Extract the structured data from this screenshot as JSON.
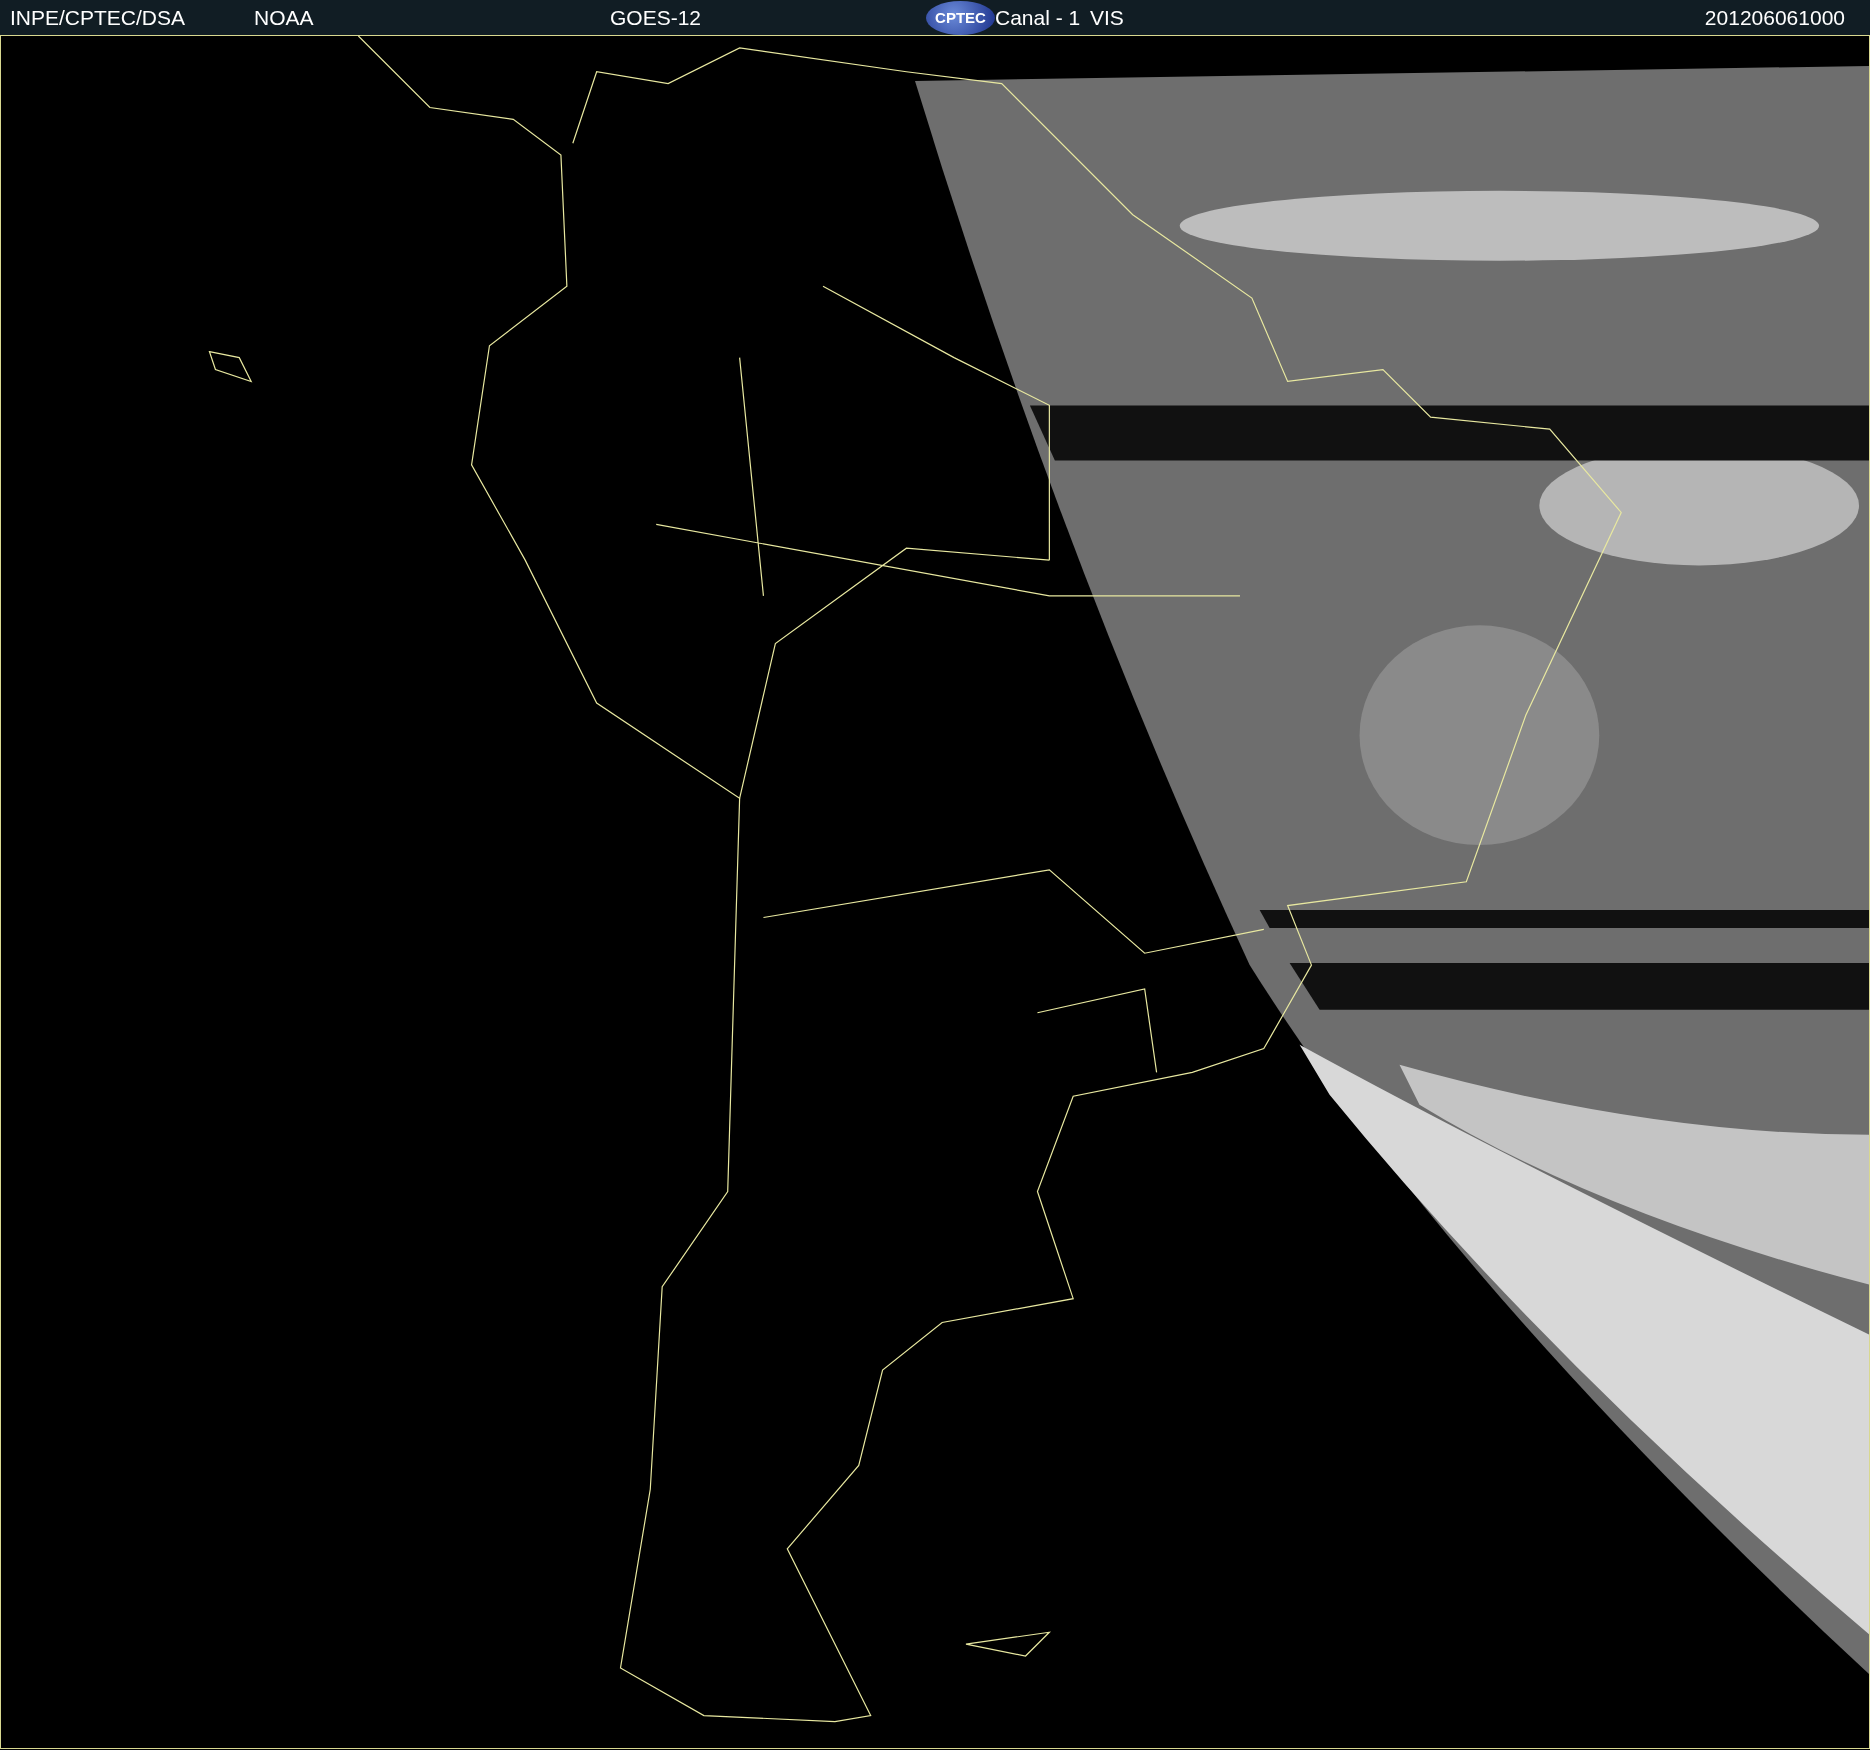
{
  "header": {
    "source": "INPE/CPTEC/DSA",
    "agency": "NOAA",
    "satellite": "GOES-12",
    "logo": "CPTEC",
    "channel": "Canal - 1",
    "band": "VIS",
    "timestamp": "201206061000"
  }
}
